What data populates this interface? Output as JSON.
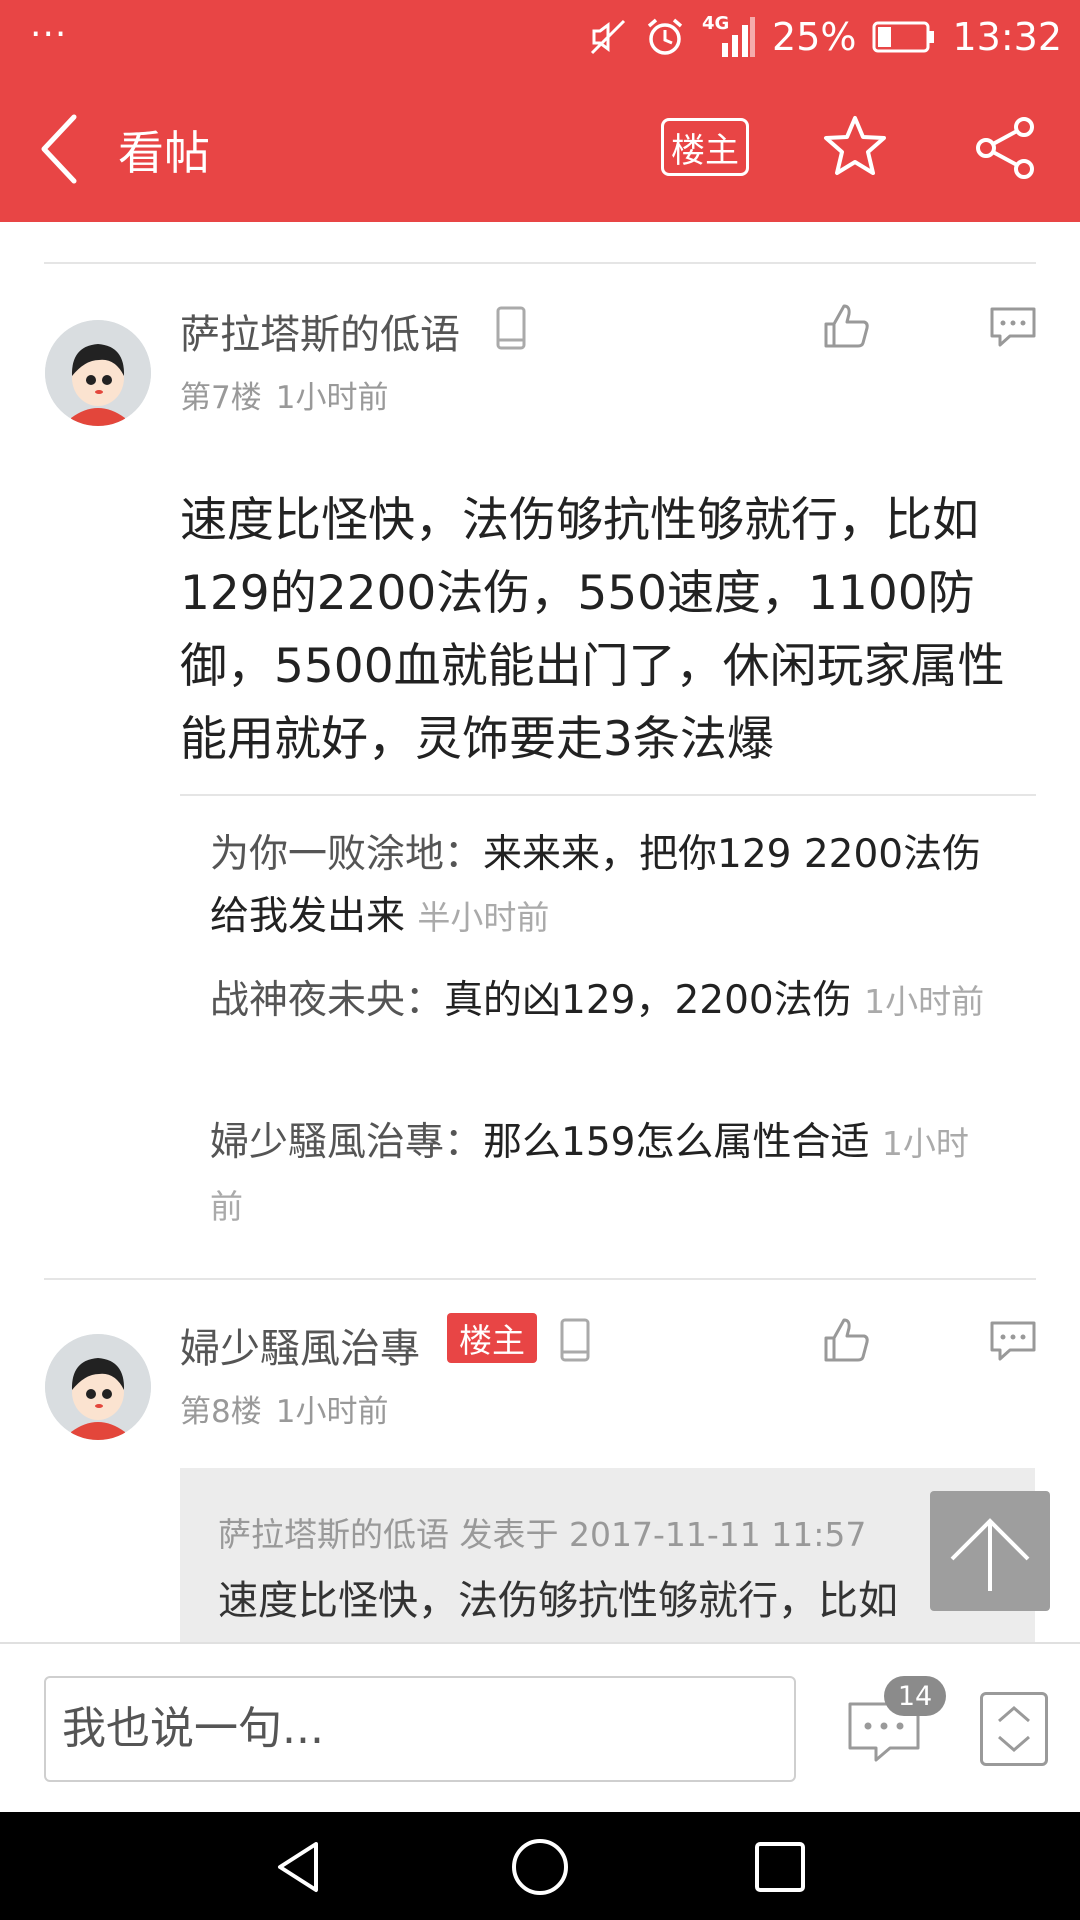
{
  "status_bar": {
    "left_dots": "···",
    "network": "4G",
    "battery": "25%",
    "time": "13:32"
  },
  "header": {
    "title": "看帖",
    "louzhu_button": "楼主"
  },
  "posts": [
    {
      "username": "萨拉塔斯的低语",
      "floor": "第7楼",
      "time": "1小时前",
      "text": "速度比怪快，法伤够抗性够就行，比如129的2200法伤，550速度，1100防御，5500血就能出门了，休闲玩家属性能用就好，灵饰要走3条法爆",
      "replies": [
        {
          "name": "为你一败涂地：",
          "text": "来来来，把你129 2200法伤给我发出来",
          "time": "半小时前"
        },
        {
          "name": "战神夜未央：",
          "text": "真的凶129，2200法伤",
          "time": "1小时前"
        },
        {
          "name": "婦少騷風治專：",
          "text": "那么159怎么属性合适",
          "time": "1小时前"
        }
      ]
    },
    {
      "username": "婦少騷風治專",
      "badge": "楼主",
      "floor": "第8楼",
      "time": "1小时前",
      "quote": {
        "header": "萨拉塔斯的低语 发表于 2017-11-11 11:57",
        "text": "速度比怪快，法伤够抗性够就行，比如"
      }
    }
  ],
  "bottom_bar": {
    "input_placeholder": "我也说一句...",
    "comment_count": "14"
  },
  "colors": {
    "brand_red": "#e84545",
    "nav_black": "#000000"
  },
  "icons": [
    "back-icon",
    "star-icon",
    "share-icon",
    "phone-icon",
    "like-icon",
    "comment-icon",
    "scroll-top-icon",
    "page-nav-icon"
  ]
}
